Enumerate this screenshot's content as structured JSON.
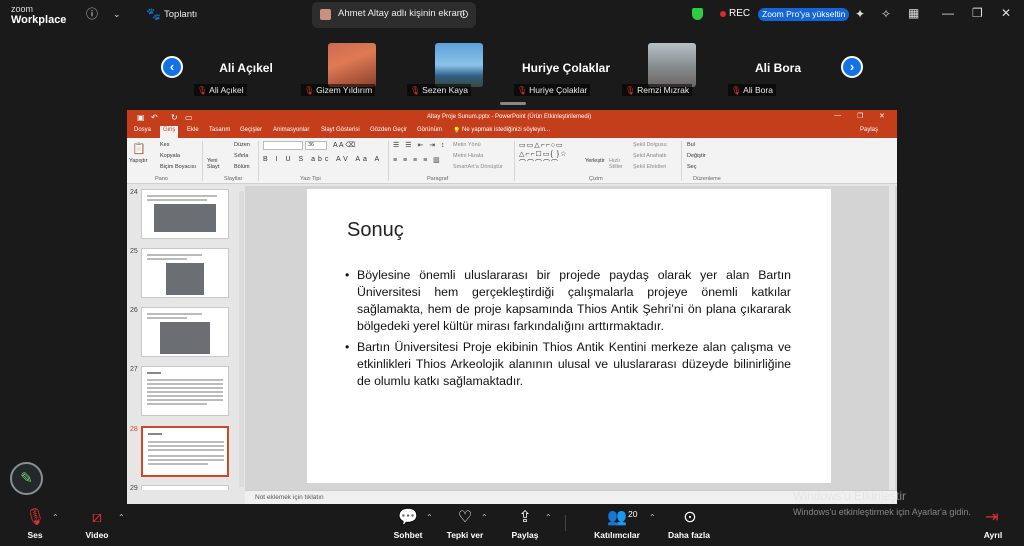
{
  "app": {
    "logo_top": "zoom",
    "logo_bottom": "Workplace"
  },
  "topbar": {
    "meeting_tab": "Toplantı",
    "share_title": "Ahmet Altay adlı kişinin ekranı",
    "rec_label": "REC",
    "upgrade_label": "Zoom Pro'ya yükseltin"
  },
  "participants": {
    "tiles": [
      {
        "big_name": "Ali Açıkel",
        "label": "Ali Açıkel"
      },
      {
        "big_name": "",
        "label": "Gizem Yıldırım"
      },
      {
        "big_name": "",
        "label": "Sezen Kaya"
      },
      {
        "big_name": "Huriye Çolaklar",
        "label": "Huriye Çolaklar"
      },
      {
        "big_name": "",
        "label": "Remzi Mızrak"
      },
      {
        "big_name": "Ali Bora",
        "label": "Ali Bora"
      }
    ]
  },
  "ppt": {
    "window_title": "Altay Proje Sunum.pptx - PowerPoint (Ürün Etkinleştirilemedi)",
    "share_label": "Paylaş",
    "tell_me": "Ne yapmak istediğinizi söyleyin...",
    "tabs": [
      "Dosya",
      "Giriş",
      "Ekle",
      "Tasarım",
      "Geçişler",
      "Animasyonlar",
      "Slayt Gösterisi",
      "Gözden Geçir",
      "Görünüm"
    ],
    "ribbon": {
      "paste": "Yapıştır",
      "cut": "Kes",
      "copy": "Kopyala",
      "format_painter": "Biçim Boyacısı",
      "new_slide": "Yeni Slayt",
      "layout": "Düzen",
      "reset": "Sıfırla",
      "section": "Bölüm",
      "font_size": "36",
      "text_direction": "Metin Yönü",
      "align_text": "Metni Hizala",
      "smartart": "SmartArt'a Dönüştür",
      "arrange": "Yerleştir",
      "quick_styles": "Hızlı Stiller",
      "shape_fill": "Şekil Dolgusu",
      "shape_outline": "Şekil Anahattı",
      "shape_effects": "Şekil Efektleri",
      "find": "Bul",
      "replace": "Değiştir",
      "select": "Seç",
      "groups": [
        "Pano",
        "Slaytlar",
        "Yazı Tipi",
        "Paragraf",
        "Çizim",
        "Düzenleme"
      ]
    },
    "thumbnails": [
      {
        "num": "24"
      },
      {
        "num": "25"
      },
      {
        "num": "26"
      },
      {
        "num": "27"
      },
      {
        "num": "28"
      },
      {
        "num": "29"
      }
    ],
    "slide": {
      "title": "Sonuç",
      "bullets": [
        "Böylesine önemli uluslararası bir projede paydaş olarak yer alan Bartın Üniversitesi hem gerçekleştirdiği çalışmalarla projeye önemli katkılar sağlamakta, hem de proje kapsamında Thios Antik Şehri’ni ön plana çıkararak bölgedeki yerel kültür mirası farkındalığını arttırmaktadır.",
        "Bartın Üniversitesi Proje ekibinin Thios Antik Kentini merkeze alan çalışma ve etkinlikleri Thios Arkeolojik alanının ulusal ve uluslararası düzeyde bilinirliğine de olumlu katkı sağlamaktadır."
      ]
    },
    "notes_placeholder": "Not eklemek için tıklatın"
  },
  "bottombar": {
    "audio": "Ses",
    "video": "Video",
    "chat": "Sohbet",
    "react": "Tepki ver",
    "share": "Paylaş",
    "participants": "Katılımcılar",
    "participants_count": "20",
    "more": "Daha fazla",
    "leave": "Ayrıl"
  },
  "watermark": {
    "line1": "Windows'u Etkinleştir",
    "line2": "Windows'u etkinleştirmek için Ayarlar'a gidin."
  },
  "colors": {
    "ppt_accent": "#c43e1c",
    "zoom_blue": "#1472e8",
    "rec": "#e02828"
  }
}
